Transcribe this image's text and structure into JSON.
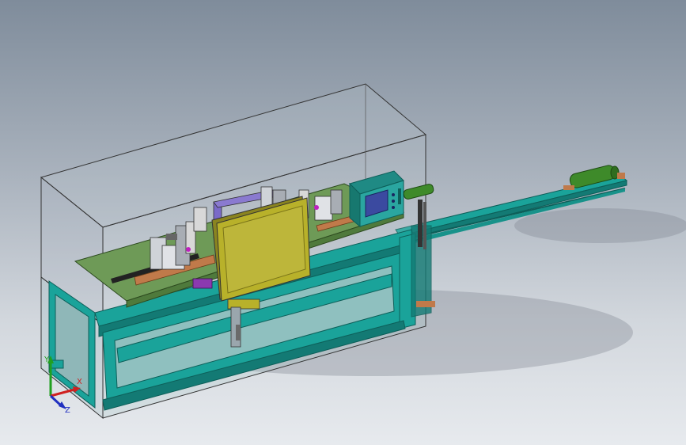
{
  "view": {
    "background_top": "#7f8c9b",
    "background_bottom": "#e7eaee"
  },
  "model": {
    "frame_color": "#1aa39a",
    "plate_color": "#6e9a57",
    "panel_color": "#b8b12a",
    "hmi_color": "#2aa6a0",
    "hmi_screen_color": "#3b4aa0",
    "roller_color": "#3e8a2a"
  },
  "triad": {
    "x_label": "X",
    "y_label": "Y",
    "z_label": "Z",
    "x_color": "#d02020",
    "y_color": "#20a020",
    "z_color": "#2030c0"
  }
}
